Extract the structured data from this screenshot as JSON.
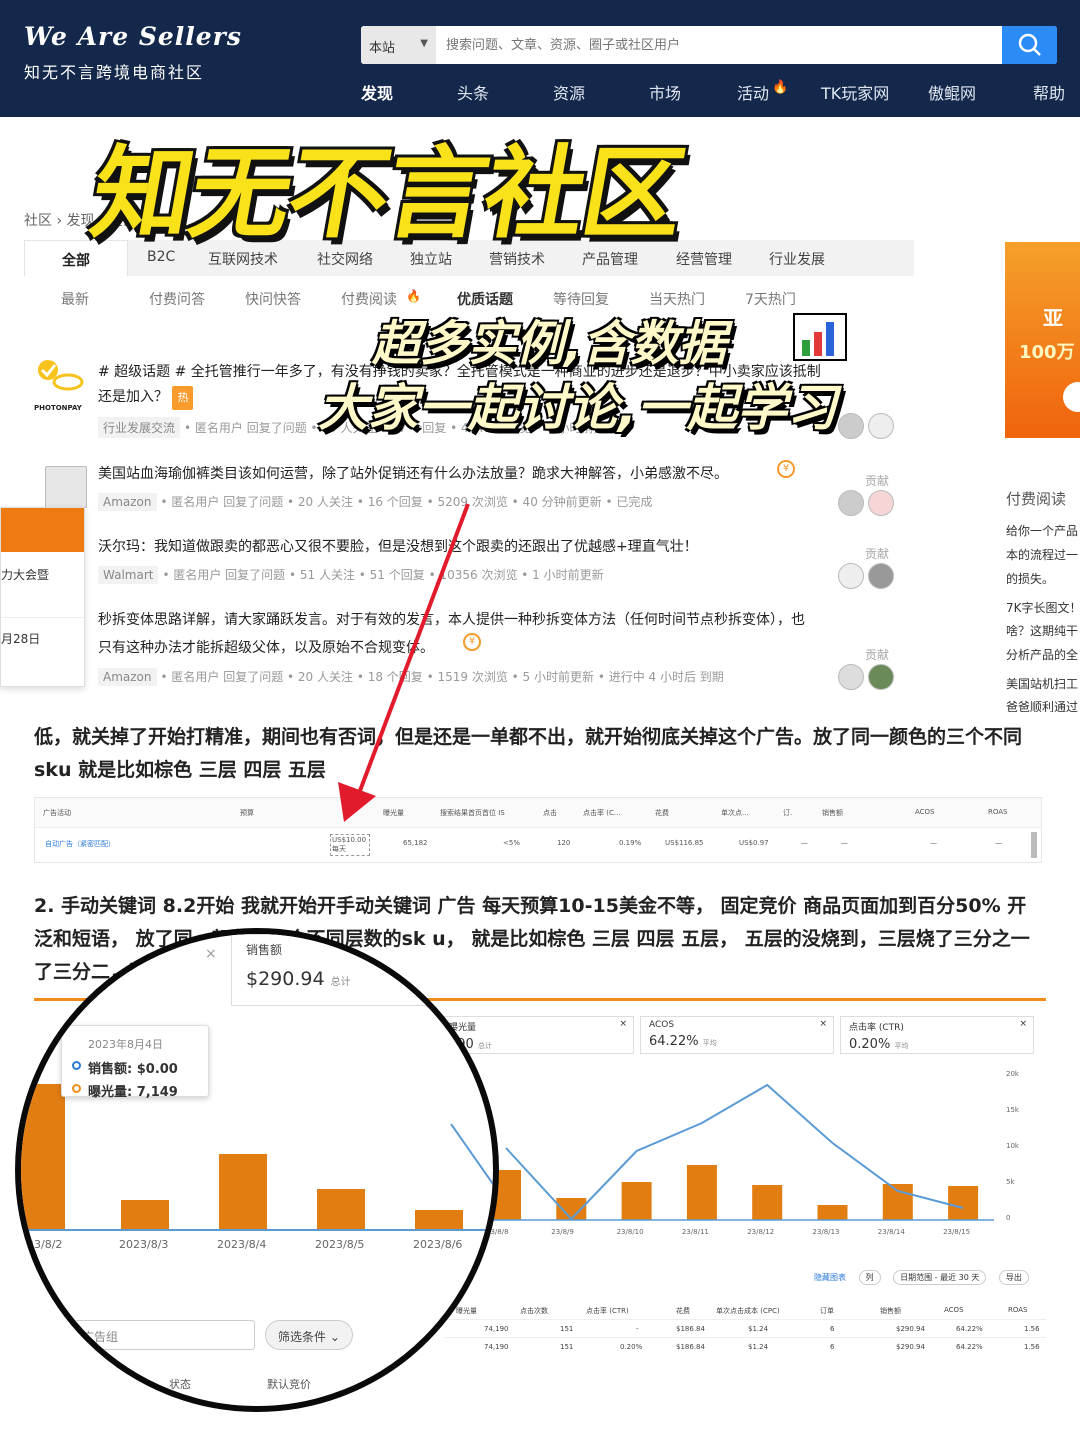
{
  "brand": {
    "en": "We Are Sellers",
    "zh": "知无不言跨境电商社区"
  },
  "search": {
    "scope": "本站",
    "placeholder": "搜索问题、文章、资源、圈子或社区用户"
  },
  "nav": [
    "发现",
    "头条",
    "资源",
    "市场",
    "活动",
    "TK玩家网",
    "傲鲲网",
    "帮助"
  ],
  "overlay": {
    "title": "知无不言社区",
    "line1": "超多实例,含数据",
    "line2": "大家一起讨论,一起学习"
  },
  "breadcrumb": "社区 › 发现 › 全部",
  "tabs": [
    "全部",
    "B2C",
    "互联网技术",
    "社交网络",
    "独立站",
    "营销技术",
    "产品管理",
    "经营管理",
    "行业发展"
  ],
  "subtabs": [
    "最新",
    "付费问答",
    "快问快答",
    "付费阅读",
    "优质话题",
    "等待回复",
    "当天热门",
    "7天热门"
  ],
  "questions": [
    {
      "title": "# 超级话题 # 全托管推行一年多了，有没有挣钱的卖家？全托管模式是一种商业的进步还是退步？中小卖家应该抵制",
      "title2": "还是加入？",
      "hot": "热",
      "tag": "行业发展交流",
      "meta": "• 匿名用户 回复了问题 • 39 人关注 • 27 个回复 • 4641 次浏览 • 6 小时前更新",
      "logo": "PHOTONPAY"
    },
    {
      "title": "美国站血海瑜伽裤类目该如何运营，除了站外促销还有什么办法放量？跪求大神解答，小弟感激不尽。",
      "tag": "Amazon",
      "meta": "• 匿名用户 回复了问题 • 20 人关注 • 16 个回复 • 5209 次浏览 • 40 分钟前更新 • 已完成",
      "gx": "贡献"
    },
    {
      "title": "沃尔玛：我知道做跟卖的都恶心又很不要脸，但是没想到这个跟卖的还跟出了优越感+理直气壮！",
      "tag": "Walmart",
      "meta": "• 匿名用户 回复了问题 • 51 人关注 • 51 个回复 • 10356 次浏览 • 1 小时前更新",
      "gx": "贡献"
    },
    {
      "title": "秒拆变体思路详解，请大家踊跃发言。对于有效的发言，本人提供一种秒拆变体方法（任何时间节点秒拆变体），也",
      "title2": "只有这种办法才能拆超级父体，以及原始不合规变体。",
      "tag": "Amazon",
      "meta": "• 匿名用户 回复了问题 • 20 人关注 • 18 个回复 • 1519 次浏览 • 5 小时前更新 • 进行中 4 小时后 到期",
      "gx": "贡献"
    }
  ],
  "side": {
    "banner1": "亚",
    "banner2": "100万",
    "title": "付费阅读",
    "lines": [
      "给你一个产品",
      "本的流程过一",
      "的损失。",
      "7K字长图文！",
      "啥？这期纯干",
      "分析产品的全",
      "美国站机扫工",
      "爸爸顺利通过"
    ]
  },
  "leftcard": {
    "l1": "力大会暨",
    "l2": "月28日"
  },
  "article": {
    "p1a": "低，就关掉了开始打精准，期间也有否词，但是还是一单都不出，就开始彻底关掉这个广告。放了同一颜色的三个不同",
    "p1b": "sku  就是比如棕色 三层 四层 五层",
    "p2a": "2. 手动关键词   8.2开始 我就开始开手动关键词 广告  每天预算10-15美金不等， 固定竞价 商品页面加到百分50%   开",
    "p2b": "泛和短语，  放了同一颜色的三个不同层数的sk u，  就是比如棕色 三层 四层 五层， 五层的没烧到，三层烧了三分之一",
    "p2c": "了三分二，这也是为什么价格便宜的原因。"
  },
  "adtable": {
    "headers": [
      "广告活动",
      "预算",
      "曝光量",
      "搜索结果首页首位 IS",
      "点击",
      "点击率 (C...",
      "花费",
      "单次点...",
      "订.",
      "销售额",
      "ACOS",
      "ROAS"
    ],
    "row": [
      "自动广告（紧密匹配）",
      "US$10.00 每天",
      "65,182",
      "<5%",
      "120",
      "0.19%",
      "US$116.85",
      "US$0.97",
      "—",
      "—",
      "—",
      "—"
    ]
  },
  "chart_data": {
    "type": "bar",
    "categories": [
      "2023/8/2",
      "2023/8/3",
      "2023/8/4",
      "2023/8/5",
      "2023/8/6",
      "2023/8/7",
      "2023/8/8",
      "2023/8/9",
      "2023/8/10",
      "2023/8/11",
      "2023/8/12",
      "2023/8/13",
      "2023/8/14",
      "2023/8/15"
    ],
    "series": [
      {
        "name": "销售额",
        "values": [
          null,
          null,
          null,
          null,
          null,
          null,
          null,
          0,
          null,
          null,
          null,
          null,
          null,
          null
        ]
      },
      {
        "name": "曝光量",
        "values": [
          null,
          null,
          7149,
          null,
          null,
          null,
          null,
          null,
          null,
          null,
          null,
          null,
          null,
          null
        ]
      }
    ],
    "right_ticks": [
      "20k",
      "15k",
      "10k",
      "5k",
      "0"
    ],
    "cards": [
      {
        "label": "销售额",
        "value": "$290.94",
        "unit": "总计"
      },
      {
        "label": "曝光量",
        "value": "190",
        "unit": "总计"
      },
      {
        "label": "ACOS",
        "value": "64.22%",
        "unit": "平均"
      },
      {
        "label": "点击率 (CTR)",
        "value": "0.20%",
        "unit": "平均"
      }
    ],
    "tooltip": {
      "date": "2023年8月4日",
      "sales": "销售额: $0.00",
      "impr": "曝光量: 7,149"
    }
  },
  "bottom": {
    "filter_placeholder": "广告组",
    "filter_btn": "筛选条件",
    "status": "状态",
    "bid": "默认竞价",
    "controls": [
      "隐藏图表",
      "列",
      "日期范围 - 最近 30 天",
      "导出"
    ],
    "headers": [
      "曝光量",
      "点击次数",
      "点击率 (CTR)",
      "花费",
      "单次点击成本 (CPC)",
      "订单",
      "销售额",
      "ACOS",
      "ROAS"
    ],
    "rows": [
      [
        "74,190",
        "151",
        "-",
        "$186.84",
        "$1.24",
        "6",
        "$290.94",
        "64.22%",
        "1.56"
      ],
      [
        "74,190",
        "151",
        "0.20%",
        "$186.84",
        "$1.24",
        "6",
        "$290.94",
        "64.22%",
        "1.56"
      ]
    ]
  }
}
